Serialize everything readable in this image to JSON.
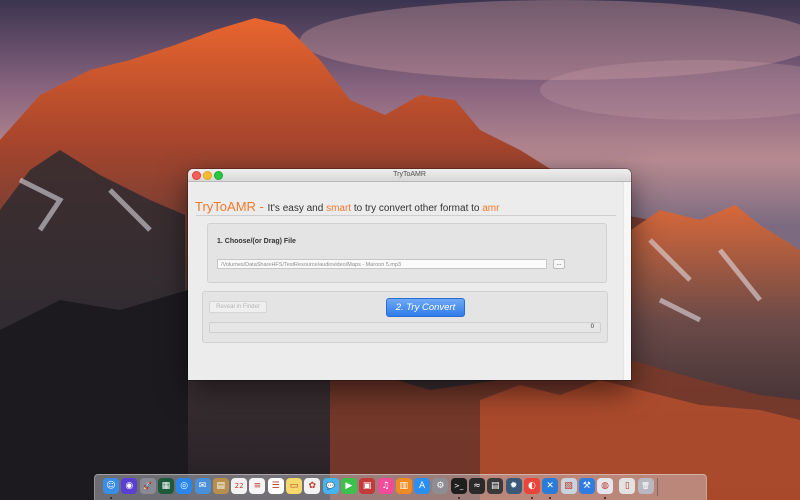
{
  "window": {
    "title": "TryToAMR",
    "app_name": "TryToAMR",
    "tagline_dash": " - ",
    "tagline_part1": "It's easy and ",
    "tagline_smart": "smart",
    "tagline_part2": " to try convert other format to ",
    "tagline_amr": "amr"
  },
  "choose": {
    "label": "1. Choose/(or Drag) File",
    "path": "/Volumes/DataShareHFS/TestResource/audiovideo/Maps - Maroon 5.mp3",
    "browse_label": "..."
  },
  "convert": {
    "reveal_label": "Reveal in Finder",
    "convert_label": "2. Try Convert",
    "progress_value": "0",
    "progress_fraction": 0
  },
  "colors": {
    "accent_orange": "#f0782c",
    "button_blue": "#2f7ce8",
    "close": "#fc5f57",
    "minimize": "#fdbc2e",
    "zoom": "#28c840"
  },
  "dock": {
    "items": [
      {
        "name": "finder-icon",
        "glyph": "☺",
        "color": "#3a8ee6",
        "running": true
      },
      {
        "name": "siri-icon",
        "glyph": "◉",
        "color": "#5a3fd1",
        "running": false
      },
      {
        "name": "launchpad-icon",
        "glyph": "🚀",
        "color": "#8a8a96",
        "running": false
      },
      {
        "name": "mission-control-icon",
        "glyph": "▦",
        "color": "#1d5a3a",
        "running": false
      },
      {
        "name": "safari-icon",
        "glyph": "◎",
        "color": "#2a86e8",
        "running": false
      },
      {
        "name": "mail-icon",
        "glyph": "✉",
        "color": "#4a90d9",
        "running": false
      },
      {
        "name": "contacts-icon",
        "glyph": "▤",
        "color": "#b8904e",
        "running": false
      },
      {
        "name": "calendar-icon",
        "glyph": "22",
        "color": "#f2f2f2",
        "running": false
      },
      {
        "name": "notes-icon",
        "glyph": "≡",
        "color": "#f5f5f5",
        "running": false
      },
      {
        "name": "reminders-icon",
        "glyph": "☰",
        "color": "#ffffff",
        "running": false
      },
      {
        "name": "stickies-icon",
        "glyph": "▭",
        "color": "#f5d96b",
        "running": false
      },
      {
        "name": "photos-icon",
        "glyph": "✿",
        "color": "#f2f2f2",
        "running": false
      },
      {
        "name": "messages-icon",
        "glyph": "💬",
        "color": "#46b4f0",
        "running": false
      },
      {
        "name": "facetime-icon",
        "glyph": "▶",
        "color": "#3bc24c",
        "running": false
      },
      {
        "name": "photo-booth-icon",
        "glyph": "▣",
        "color": "#c23a3a",
        "running": false
      },
      {
        "name": "itunes-icon",
        "glyph": "♫",
        "color": "#f04c9a",
        "running": false
      },
      {
        "name": "ibooks-icon",
        "glyph": "▥",
        "color": "#f08a24",
        "running": false
      },
      {
        "name": "app-store-icon",
        "glyph": "A",
        "color": "#2b8ef0",
        "running": false
      },
      {
        "name": "system-preferences-icon",
        "glyph": "⚙",
        "color": "#8d8d92",
        "running": false
      },
      {
        "name": "terminal-icon",
        "glyph": ">_",
        "color": "#1e1e1e",
        "running": true
      },
      {
        "name": "activity-monitor-icon",
        "glyph": "≈",
        "color": "#2a2a2a",
        "running": false
      },
      {
        "name": "console-icon",
        "glyph": "▤",
        "color": "#3a3a3a",
        "running": false
      },
      {
        "name": "network-utility-icon",
        "glyph": "✹",
        "color": "#3a5a78",
        "running": false
      },
      {
        "name": "chrome-icon",
        "glyph": "◐",
        "color": "#e9453a",
        "running": true
      },
      {
        "name": "vscode-icon",
        "glyph": "✕",
        "color": "#2b7cd6",
        "running": true
      },
      {
        "name": "preview-icon",
        "glyph": "▧",
        "color": "#c9d4e0",
        "running": false
      },
      {
        "name": "xcode-icon",
        "glyph": "⚒",
        "color": "#2f7de0",
        "running": false
      },
      {
        "name": "trytoamr-icon",
        "glyph": "◍",
        "color": "#e6e6ee",
        "running": true
      },
      {
        "name": "document-icon",
        "glyph": "▯",
        "color": "#e2e2e2",
        "running": false
      },
      {
        "name": "trash-icon",
        "glyph": "🗑",
        "color": "#b8b8c0",
        "running": false
      }
    ]
  }
}
